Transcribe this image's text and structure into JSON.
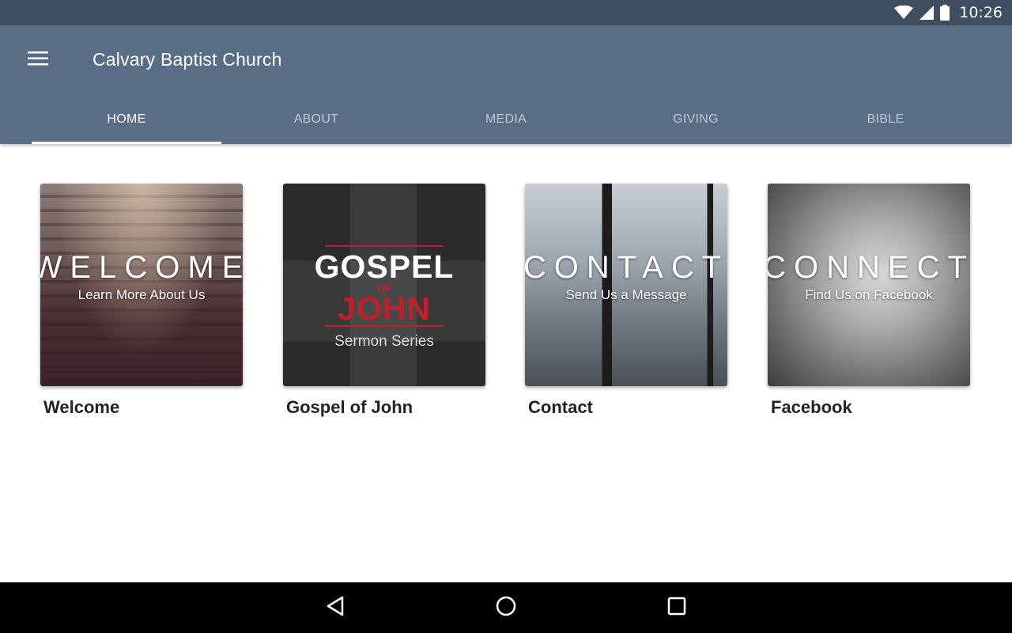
{
  "status_bar": {
    "time": "10:26"
  },
  "app_bar": {
    "title": "Calvary Baptist Church",
    "tabs": [
      {
        "label": "HOME",
        "active": true
      },
      {
        "label": "ABOUT",
        "active": false
      },
      {
        "label": "MEDIA",
        "active": false
      },
      {
        "label": "GIVING",
        "active": false
      },
      {
        "label": "BIBLE",
        "active": false
      }
    ]
  },
  "cards": [
    {
      "caption": "Welcome",
      "overlay_title": "WELCOME",
      "overlay_subtitle": "Learn More About Us"
    },
    {
      "caption": "Gospel of John",
      "art_title": "GOSPEL",
      "art_of": "OF",
      "art_john": "JOHN",
      "art_series": "Sermon Series"
    },
    {
      "caption": "Contact",
      "overlay_title": "CONTACT",
      "overlay_subtitle": "Send Us a Message"
    },
    {
      "caption": "Facebook",
      "overlay_title": "CONNECT",
      "overlay_subtitle": "Find Us on Facebook"
    }
  ],
  "colors": {
    "status_bar": "#3f4e60",
    "app_bar": "#586d86",
    "gospel_red": "#c0202a"
  },
  "icons": {
    "menu": "hamburger-icon",
    "wifi": "wifi-icon",
    "signal": "cell-signal-icon",
    "battery": "battery-icon",
    "back": "back-triangle-icon",
    "home": "home-circle-icon",
    "recents": "recents-square-icon"
  }
}
